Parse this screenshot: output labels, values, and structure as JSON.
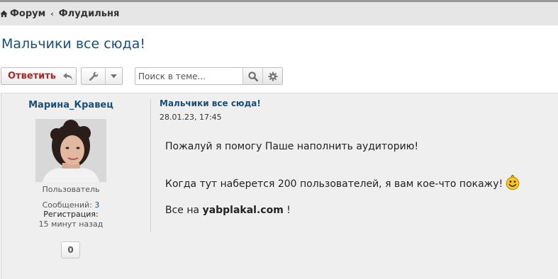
{
  "breadcrumb": {
    "home": "Форум",
    "section": "Флудильня"
  },
  "page_title": "Мальчики все сюда!",
  "toolbar": {
    "reply_label": "Ответить",
    "search_placeholder": "Поиск в теме..."
  },
  "post": {
    "author": "Марина_Кравец",
    "role": "Пользователь",
    "posts_label": "Сообщений:",
    "posts_count": "3",
    "reg_label": "Регистрация:",
    "reg_value": "15 минут назад",
    "reputation": "0",
    "title": "Мальчики все сюда!",
    "date": "28.01.23, 17:45",
    "line1": "Пожалуй я помогу Паше наполнить аудиторию!",
    "line2": "Когда тут наберется 200 пользователей, я вам кое-что покажу!",
    "line3_prefix": "Все на",
    "line3_site": "yabplakal.com",
    "line3_suffix": "!"
  },
  "colors": {
    "accent": "#1a4f7a",
    "reply": "#a52a2a",
    "post_bg": "#efefef",
    "topbar_bg": "#e6e6e6"
  },
  "icons": [
    "home-icon",
    "reply-arrow-icon",
    "wrench-icon",
    "caret-down-icon",
    "search-icon",
    "gear-icon",
    "smiley-icon"
  ]
}
